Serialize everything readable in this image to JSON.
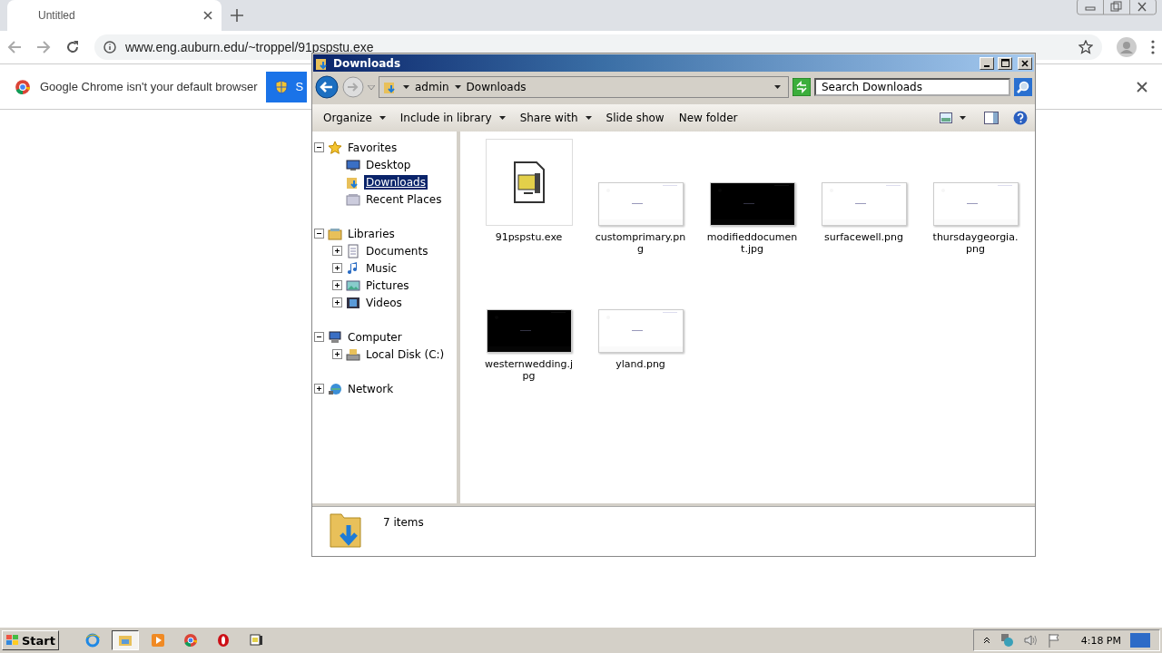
{
  "browser": {
    "tabs": [
      {
        "title": "Untitled",
        "selected": true
      }
    ],
    "url": "www.eng.auburn.edu/~troppel/91pspstu.exe",
    "infobar": {
      "message": "Google Chrome isn't your default browser",
      "button": "S"
    }
  },
  "explorer": {
    "title": "Downloads",
    "breadcrumb": [
      "admin",
      "Downloads"
    ],
    "search": {
      "placeholder": "Search Downloads"
    },
    "commands": [
      {
        "label": "Organize",
        "dropdown": true
      },
      {
        "label": "Include in library",
        "dropdown": true
      },
      {
        "label": "Share with",
        "dropdown": true
      },
      {
        "label": "Slide show",
        "dropdown": false
      },
      {
        "label": "New folder",
        "dropdown": false
      }
    ],
    "nav": [
      {
        "label": "Favorites",
        "kind": "star",
        "expanded": true,
        "selected": false,
        "children": [
          {
            "label": "Desktop",
            "kind": "desktop",
            "selected": false
          },
          {
            "label": "Downloads",
            "kind": "downloads",
            "selected": true
          },
          {
            "label": "Recent Places",
            "kind": "recent",
            "selected": false
          }
        ]
      },
      {
        "label": "Libraries",
        "kind": "library",
        "expanded": true,
        "selected": false,
        "children": [
          {
            "label": "Documents",
            "kind": "documents",
            "expanded": false,
            "selected": false
          },
          {
            "label": "Music",
            "kind": "music",
            "expanded": false,
            "selected": false
          },
          {
            "label": "Pictures",
            "kind": "pictures",
            "expanded": false,
            "selected": false
          },
          {
            "label": "Videos",
            "kind": "videos",
            "expanded": false,
            "selected": false
          }
        ]
      },
      {
        "label": "Computer",
        "kind": "computer",
        "expanded": true,
        "selected": false,
        "children": [
          {
            "label": "Local Disk (C:)",
            "kind": "disk",
            "expanded": false,
            "selected": false
          }
        ]
      },
      {
        "label": "Network",
        "kind": "network",
        "expanded": false,
        "selected": false
      }
    ],
    "files": [
      {
        "name": "91pspstu.exe",
        "kind": "program"
      },
      {
        "name": "customprimary.png",
        "kind": "light-image"
      },
      {
        "name": "modifieddocument.jpg",
        "kind": "dark-image"
      },
      {
        "name": "surfacewell.png",
        "kind": "light-image"
      },
      {
        "name": "thursdaygeorgia.png",
        "kind": "light-image"
      },
      {
        "name": "westernwedding.jpg",
        "kind": "dark-image"
      },
      {
        "name": "yland.png",
        "kind": "light-image"
      }
    ],
    "status": "7 items"
  },
  "taskbar": {
    "start": "Start",
    "apps": [
      {
        "kind": "browser-e",
        "selected": false
      },
      {
        "kind": "folder",
        "selected": true
      },
      {
        "kind": "media",
        "selected": false
      },
      {
        "kind": "chrome",
        "selected": false
      },
      {
        "kind": "opera",
        "selected": false
      },
      {
        "kind": "program",
        "selected": false
      }
    ],
    "clock": "4:18 PM"
  }
}
